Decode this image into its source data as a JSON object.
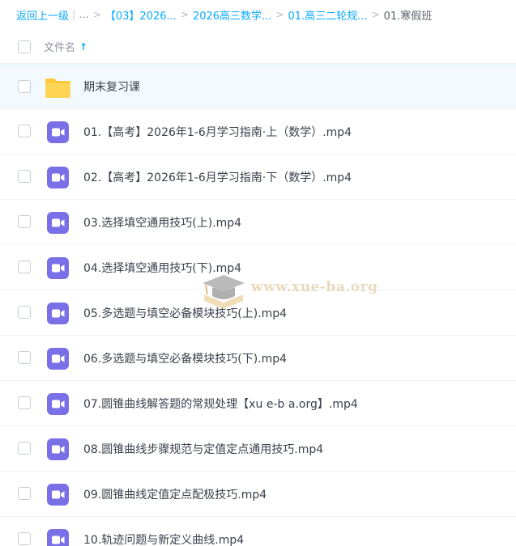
{
  "breadcrumb": {
    "back_label": "返回上一级",
    "ellipsis": "...",
    "crumbs": [
      "【03】2026...",
      "2026高三数学...",
      "01.高三二轮规..."
    ],
    "current": "01.寒假班"
  },
  "header": {
    "name_label": "文件名",
    "sort_icon": "arrow-up-icon"
  },
  "files": [
    {
      "type": "folder",
      "name": "期末复习课",
      "icon": "folder-icon"
    },
    {
      "type": "video",
      "name": "01.【高考】2026年1-6月学习指南·上（数学）.mp4",
      "icon": "video-icon"
    },
    {
      "type": "video",
      "name": "02.【高考】2026年1-6月学习指南·下（数学）.mp4",
      "icon": "video-icon"
    },
    {
      "type": "video",
      "name": "03.选择填空通用技巧(上).mp4",
      "icon": "video-icon"
    },
    {
      "type": "video",
      "name": "04.选择填空通用技巧(下).mp4",
      "icon": "video-icon"
    },
    {
      "type": "video",
      "name": "05.多选题与填空必备模块技巧(上).mp4",
      "icon": "video-icon"
    },
    {
      "type": "video",
      "name": "06.多选题与填空必备模块技巧(下).mp4",
      "icon": "video-icon"
    },
    {
      "type": "video",
      "name": "07.圆锥曲线解答题的常规处理【xu e-b a.org】.mp4",
      "icon": "video-icon"
    },
    {
      "type": "video",
      "name": "08.圆锥曲线步骤规范与定值定点通用技巧.mp4",
      "icon": "video-icon"
    },
    {
      "type": "video",
      "name": "09.圆锥曲线定值定点配极技巧.mp4",
      "icon": "video-icon"
    },
    {
      "type": "video",
      "name": "10.轨迹问题与新定义曲线.mp4",
      "icon": "video-icon"
    }
  ],
  "watermark": {
    "text": "www.xue-ba.org"
  },
  "colors": {
    "accent": "#09aaff",
    "video_icon": "#7b6fe8",
    "folder_icon": "#ffc93d",
    "selected_row": "#f2faff"
  }
}
